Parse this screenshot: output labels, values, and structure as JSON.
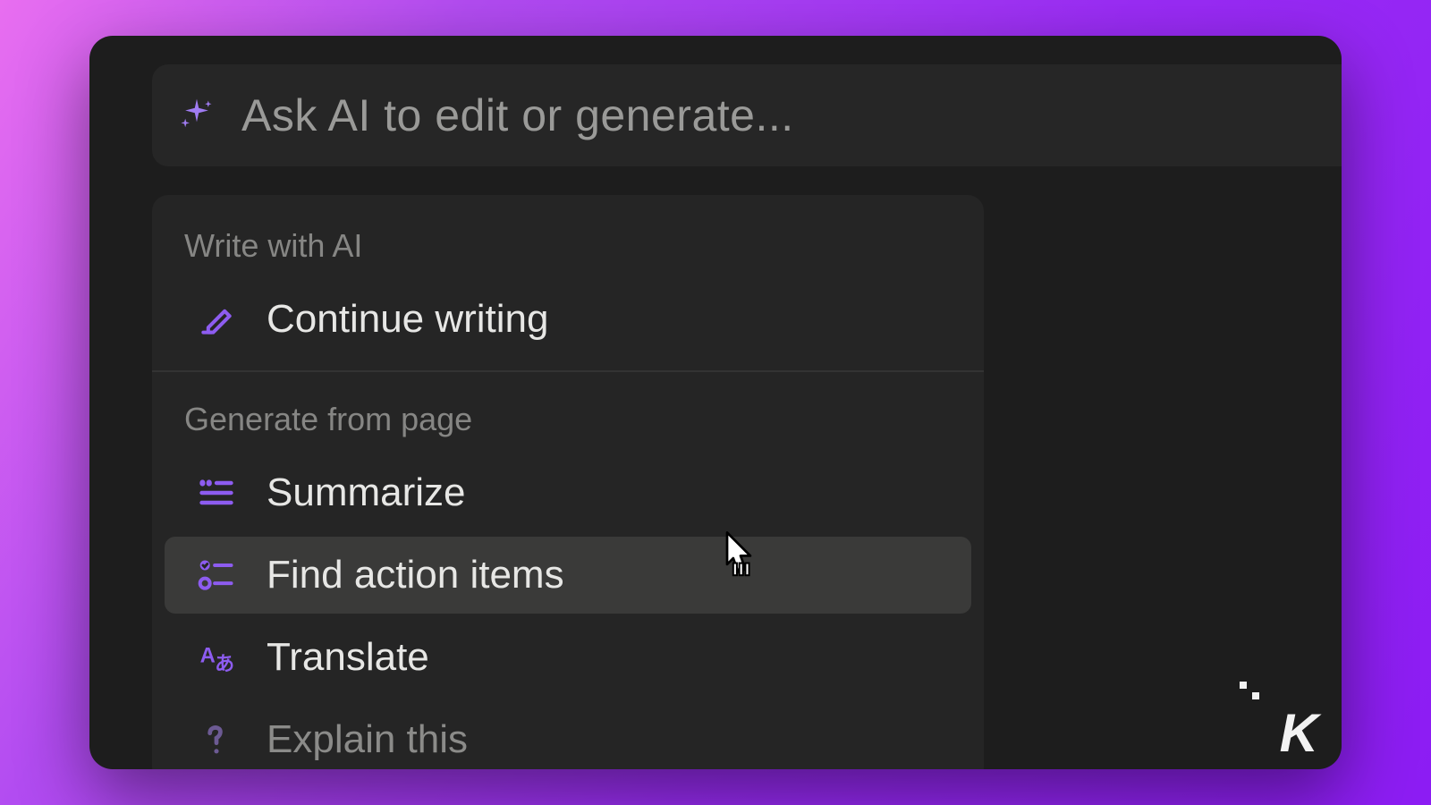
{
  "colors": {
    "accent": "#8d5cf0"
  },
  "input": {
    "placeholder": "Ask AI to edit or generate..."
  },
  "sections": {
    "write": {
      "title": "Write with AI",
      "items": [
        {
          "icon": "pencil-line-icon",
          "label": "Continue writing"
        }
      ]
    },
    "generate": {
      "title": "Generate from page",
      "items": [
        {
          "icon": "summarize-icon",
          "label": "Summarize"
        },
        {
          "icon": "action-items-icon",
          "label": "Find action items",
          "hovered": true
        },
        {
          "icon": "translate-icon",
          "label": "Translate"
        },
        {
          "icon": "question-icon",
          "label": "Explain this",
          "faded": true
        }
      ]
    }
  },
  "brand": "K"
}
